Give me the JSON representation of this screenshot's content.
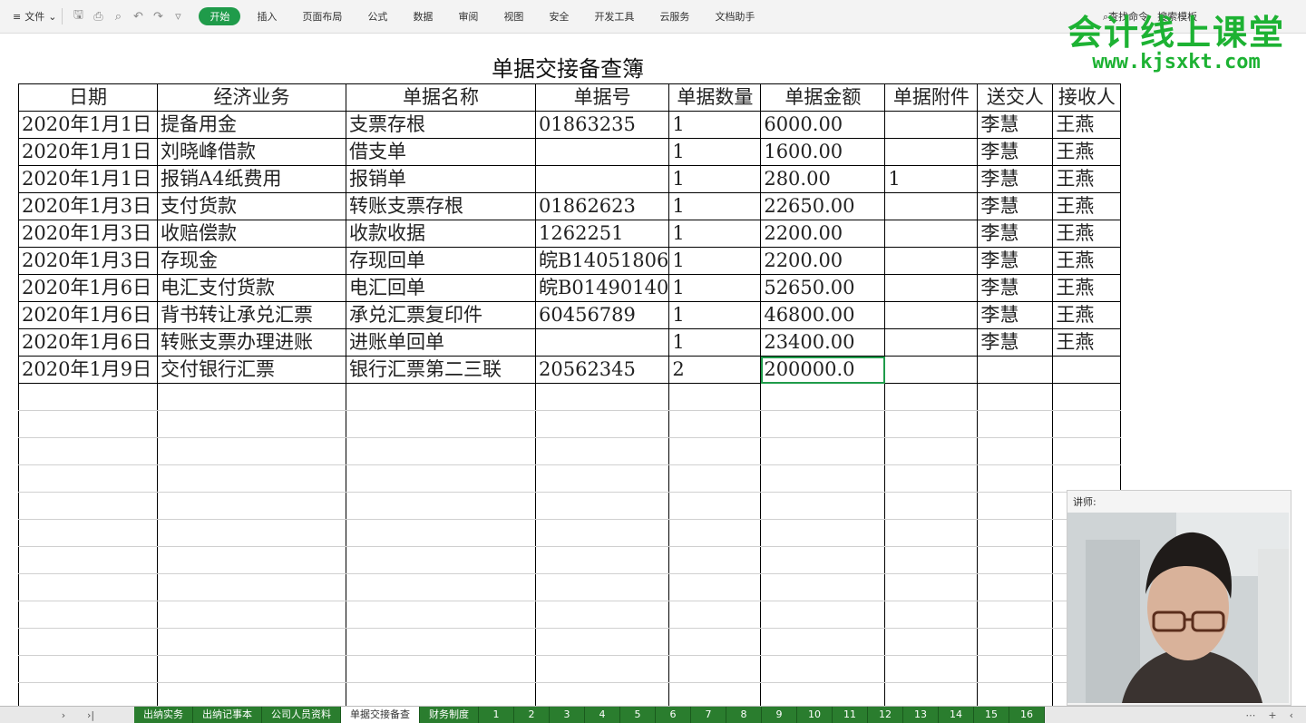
{
  "menubar": {
    "file_label": "文件",
    "tabs": [
      "开始",
      "插入",
      "页面布局",
      "公式",
      "数据",
      "审阅",
      "视图",
      "安全",
      "开发工具",
      "云服务",
      "文档助手"
    ],
    "active_tab": "开始",
    "find_label": "查找命令",
    "search_template_label": "搜索模板"
  },
  "watermark": {
    "line1": "会计线上课堂",
    "line2": "www.kjsxkt.com"
  },
  "sheet": {
    "title": "单据交接备查簿",
    "headers": [
      "日期",
      "经济业务",
      "单据名称",
      "单据号",
      "单据数量",
      "单据金额",
      "单据附件",
      "送交人",
      "接收人"
    ],
    "rows": [
      [
        "2020年1月1日",
        "提备用金",
        "支票存根",
        "01863235",
        "1",
        "6000.00",
        "",
        "李慧",
        "王燕"
      ],
      [
        "2020年1月1日",
        "刘晓峰借款",
        "借支单",
        "",
        "1",
        "1600.00",
        "",
        "李慧",
        "王燕"
      ],
      [
        "2020年1月1日",
        "报销A4纸费用",
        "报销单",
        "",
        "1",
        "280.00",
        "1",
        "李慧",
        "王燕"
      ],
      [
        "2020年1月3日",
        "支付货款",
        "转账支票存根",
        "01862623",
        "1",
        "22650.00",
        "",
        "李慧",
        "王燕"
      ],
      [
        "2020年1月3日",
        "收赔偿款",
        "收款收据",
        "1262251",
        "1",
        "2200.00",
        "",
        "李慧",
        "王燕"
      ],
      [
        "2020年1月3日",
        "存现金",
        "存现回单",
        "皖B14051806",
        "1",
        "2200.00",
        "",
        "李慧",
        "王燕"
      ],
      [
        "2020年1月6日",
        "电汇支付货款",
        "电汇回单",
        "皖B01490140",
        "1",
        "52650.00",
        "",
        "李慧",
        "王燕"
      ],
      [
        "2020年1月6日",
        "背书转让承兑汇票",
        "承兑汇票复印件",
        "60456789",
        "1",
        "46800.00",
        "",
        "李慧",
        "王燕"
      ],
      [
        "2020年1月6日",
        "转账支票办理进账",
        "进账单回单",
        "",
        "1",
        "23400.00",
        "",
        "李慧",
        "王燕"
      ],
      [
        "2020年1月9日",
        "交付银行汇票",
        "银行汇票第二三联",
        "20562345",
        "2",
        "200000.0",
        "",
        "",
        ""
      ]
    ],
    "empty_rows": 12
  },
  "instructor": {
    "label": "讲师:"
  },
  "sheet_tabs": {
    "named": [
      "出纳实务",
      "出纳记事本",
      "公司人员资料",
      "单据交接备查",
      "财务制度"
    ],
    "active": "单据交接备查",
    "numbered": [
      "1",
      "2",
      "3",
      "4",
      "5",
      "6",
      "7",
      "8",
      "9",
      "10",
      "11",
      "12",
      "13",
      "14",
      "15",
      "16"
    ]
  }
}
